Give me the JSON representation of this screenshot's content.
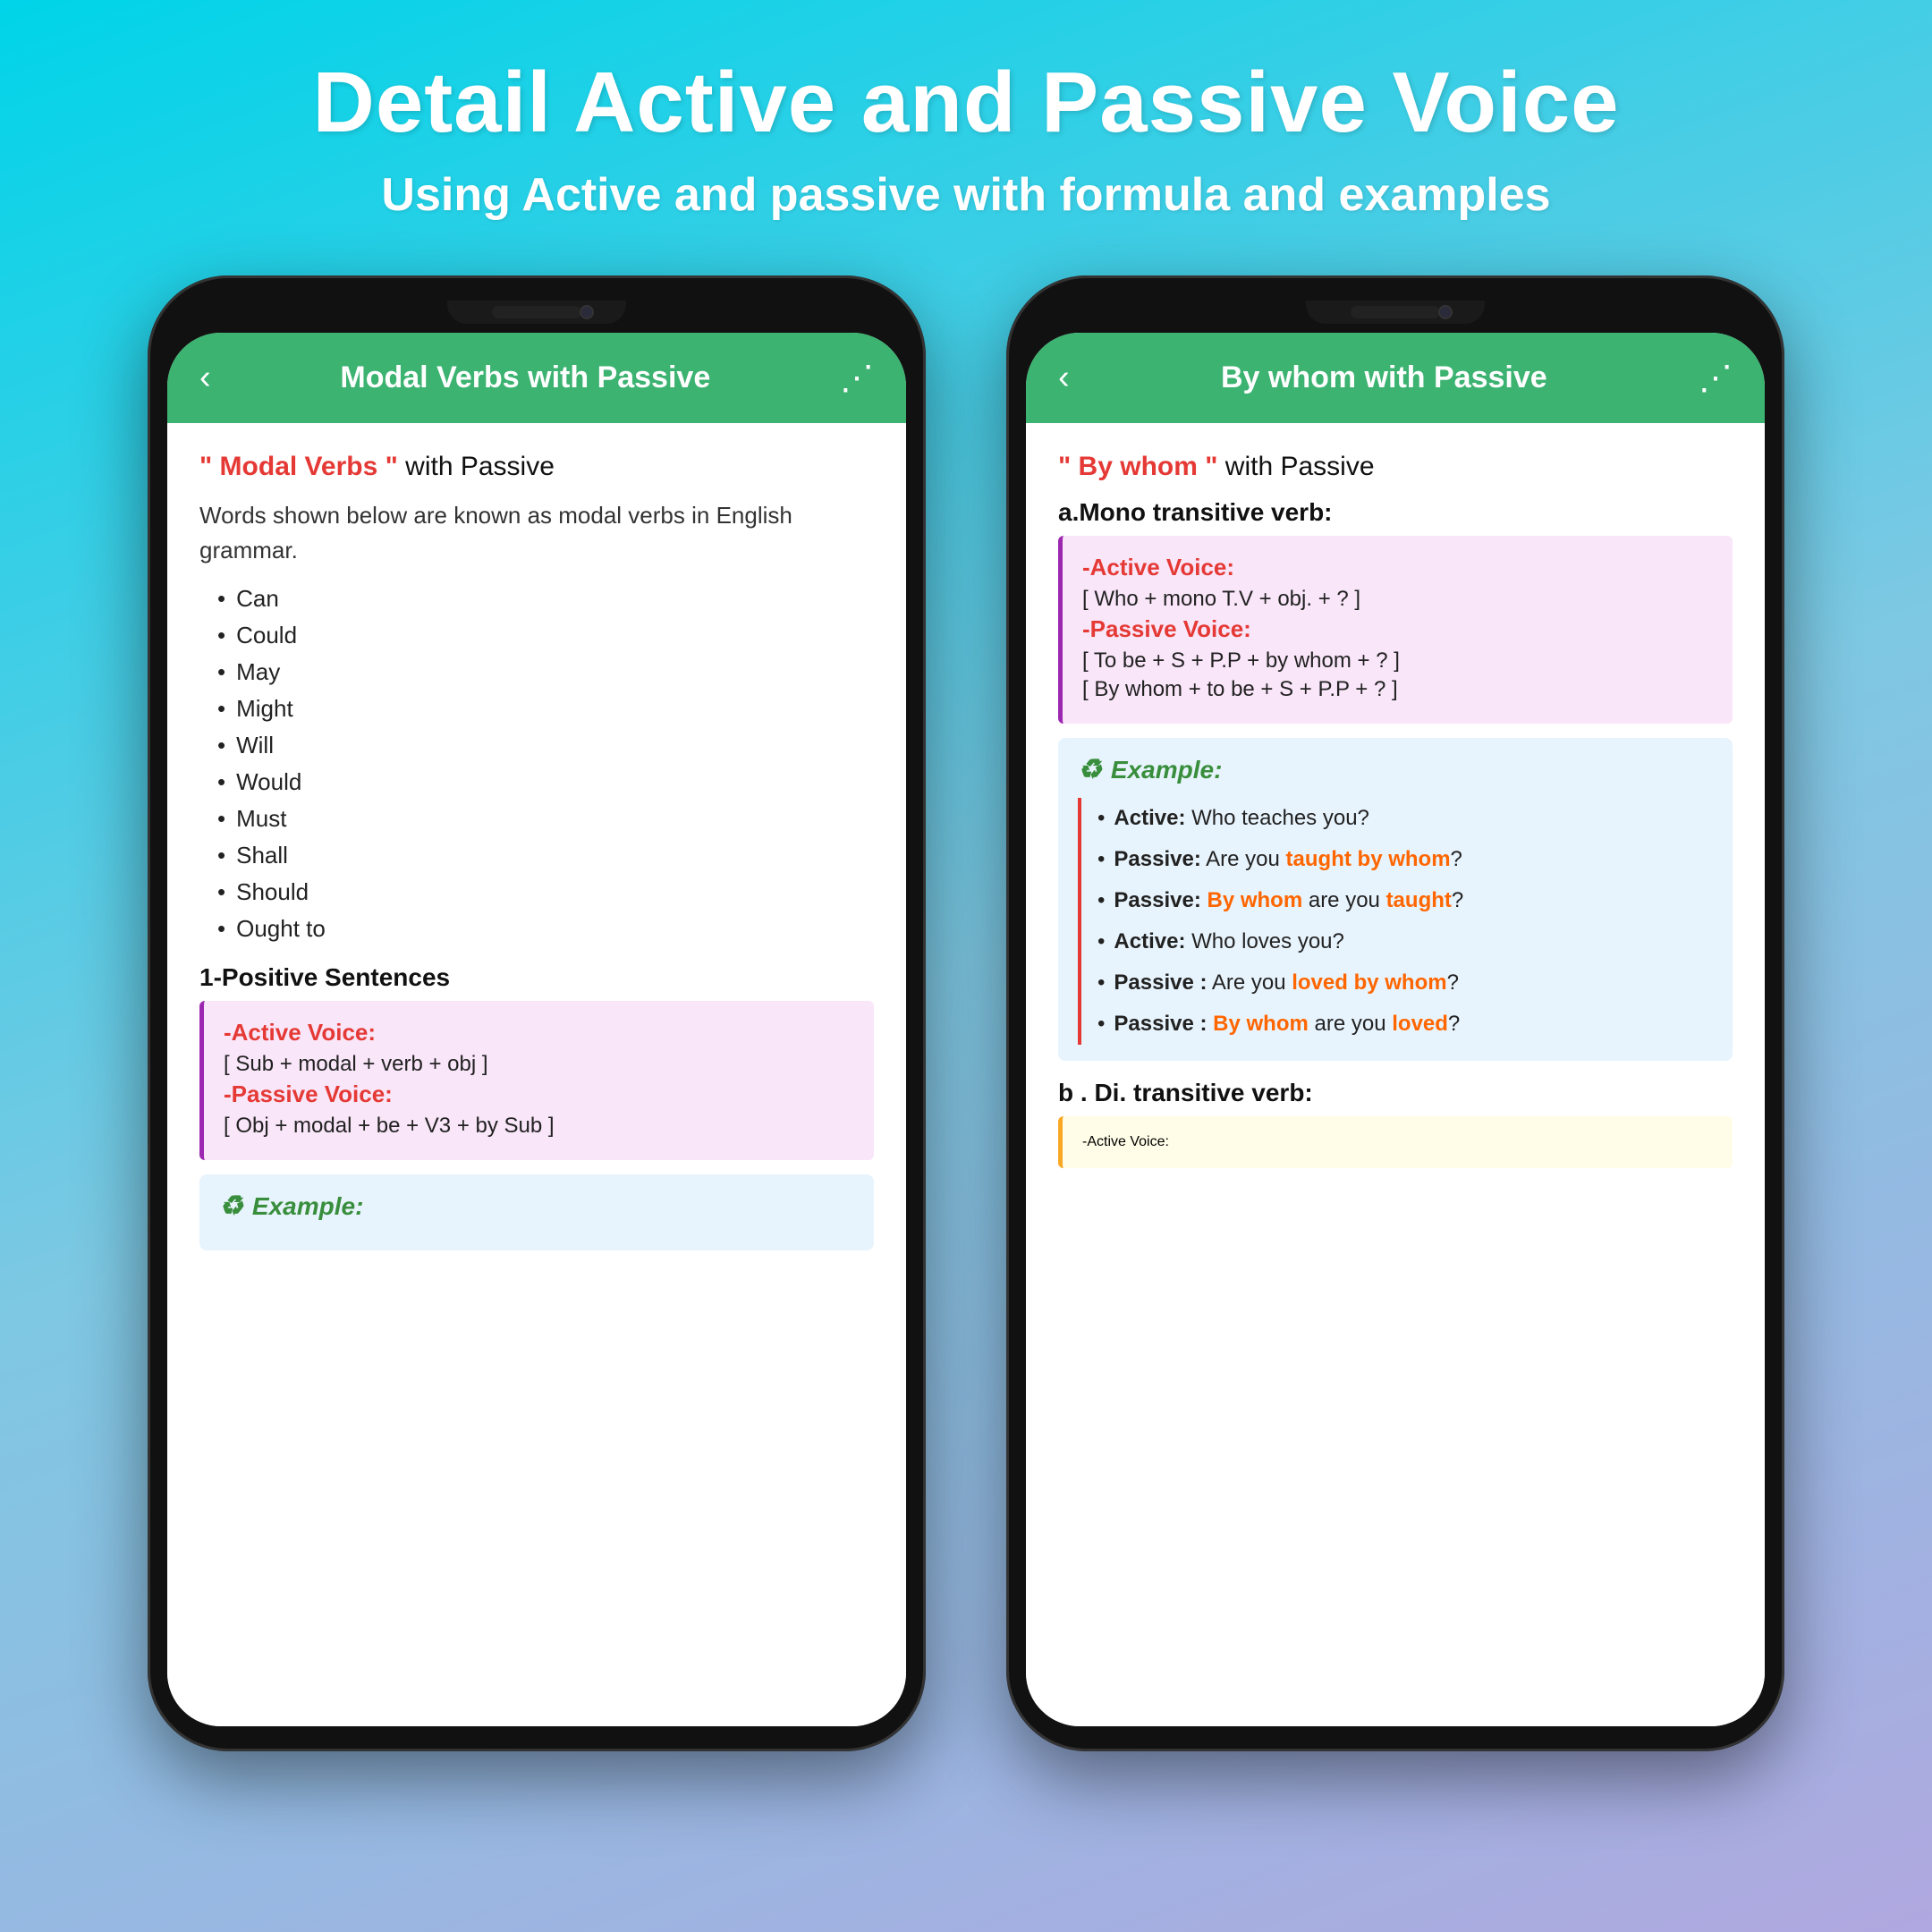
{
  "header": {
    "title": "Detail Active and Passive Voice",
    "subtitle": "Using Active and passive with formula and examples"
  },
  "phone1": {
    "app_title": "Modal Verbs with Passive",
    "section_heading_keyword": "\" Modal Verbs \"",
    "section_heading_rest": " with Passive",
    "intro": "Words shown below are known as modal verbs in English grammar.",
    "modal_verbs": [
      "Can",
      "Could",
      "May",
      "Might",
      "Will",
      "Would",
      "Must",
      "Shall",
      "Should",
      "Ought to"
    ],
    "positive_heading": "1-Positive Sentences",
    "active_label": "-Active Voice:",
    "active_formula": "[ Sub + modal + verb + obj ]",
    "passive_label": "-Passive Voice:",
    "passive_formula": "[ Obj + modal + be + V3 + by Sub ]",
    "example_header": "Example:"
  },
  "phone2": {
    "app_title": "By whom with Passive",
    "section_heading_keyword": "\" By whom \"",
    "section_heading_rest": " with Passive",
    "mono_label": "a.Mono transitive verb:",
    "active_label": "-Active Voice:",
    "active_formula": "[ Who + mono T.V + obj. + ? ]",
    "passive_label": "-Passive Voice:",
    "passive_formula1": "[ To be + S + P.P + by whom + ? ]",
    "passive_formula2": "[ By whom + to be + S + P.P + ? ]",
    "example_header": "Example:",
    "examples": [
      {
        "prefix": "Active:",
        "text": " Who teaches you?",
        "colored": "",
        "suffix": ""
      },
      {
        "prefix": "Passive:",
        "text": " Are you ",
        "colored": "taught by whom",
        "suffix": "?"
      },
      {
        "prefix": "Passive:",
        "text": " ",
        "colored_start": "By whom",
        "middle": " are you ",
        "colored_end": "taught",
        "suffix": "?"
      },
      {
        "prefix": "Active:",
        "text": " Who loves you?",
        "colored": "",
        "suffix": ""
      },
      {
        "prefix": "Passive :",
        "text": " Are you ",
        "colored": "loved by whom",
        "suffix": "?"
      },
      {
        "prefix": "Passive :",
        "text": " ",
        "colored_start": "By whom",
        "middle": " are you ",
        "colored_end": "loved",
        "suffix": "?"
      }
    ],
    "di_label": "b . Di. transitive verb:",
    "active_label2": "-Active Voice:"
  }
}
